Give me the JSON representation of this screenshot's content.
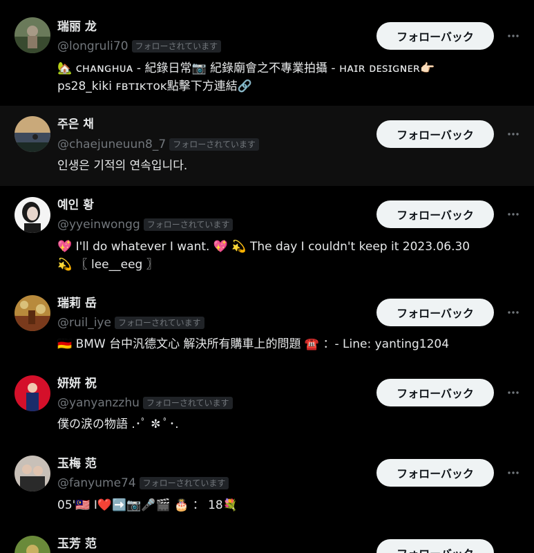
{
  "follow_back_label": "フォローバック",
  "follows_you_label": "フォローされています",
  "users": [
    {
      "display_name": "瑞丽 龙",
      "handle": "@longruli70",
      "bio_lines": [
        "🏡 ᴄʜᴀɴɢʜᴜᴀ - 紀錄日常📷 紀錄廟會之不專業拍攝 - ʜᴀɪʀ ᴅᴇꜱɪɢɴᴇʀ👉🏻",
        "ps28_kiki ꜰʙᴛɪᴋᴛᴏᴋ點擊下方連結🔗"
      ],
      "avatar_colors": [
        "#6a7a5a",
        "#a79a86",
        "#394a2f"
      ]
    },
    {
      "display_name": "주은 채",
      "handle": "@chaejuneuun8_7",
      "bio_lines": [
        "인생은 기적의 연속입니다."
      ],
      "avatar_colors": [
        "#c9a97a",
        "#3e4a5c",
        "#1c2a25"
      ]
    },
    {
      "display_name": "예인 황",
      "handle": "@yyeinwongg",
      "bio_lines": [
        "💖 I'll do whatever I want. 💖 💫 The day I couldn't keep it 2023.06.30",
        "💫 〖 lee__eeg 〗"
      ],
      "avatar_colors": [
        "#f4f4f4",
        "#1a1a1a",
        "#e8d6cc"
      ]
    },
    {
      "display_name": "瑞莉 岳",
      "handle": "@ruil_iye",
      "bio_lines": [
        "🇩🇪 BMW 台中汎德文心 解決所有購車上的問題 ☎️ ：- Line: yanting1204"
      ],
      "avatar_colors": [
        "#b88a3c",
        "#7a3a1c",
        "#d9c07a"
      ]
    },
    {
      "display_name": "妍妍 祝",
      "handle": "@yanyanzzhu",
      "bio_lines": [
        "僕の涙の物語 .･ﾟ ✼ ﾟ･."
      ],
      "avatar_colors": [
        "#d4102a",
        "#1a2c6a",
        "#f0c8b0"
      ]
    },
    {
      "display_name": "玉梅 范",
      "handle": "@fanyume74",
      "bio_lines": [
        "05'🇲🇾 I❤️➡️📷🎤🎬 🎂 ： 18💐"
      ],
      "avatar_colors": [
        "#c8c0b8",
        "#2a2a2a",
        "#e0c4b0"
      ]
    },
    {
      "display_name": "玉芳 范",
      "handle": "",
      "bio_lines": [],
      "avatar_colors": [
        "#6a8a3a",
        "#c8b060",
        "#3a5a2a"
      ]
    }
  ],
  "colors": {
    "background": "#000000",
    "hover_row": "#0f0f0f",
    "primary_text": "#e7e9ea",
    "secondary_text": "#71767b",
    "badge_bg": "#202327",
    "button_bg": "#eff3f4",
    "button_text": "#0f1419"
  },
  "icons": {
    "more": "more-horizontal-icon"
  }
}
